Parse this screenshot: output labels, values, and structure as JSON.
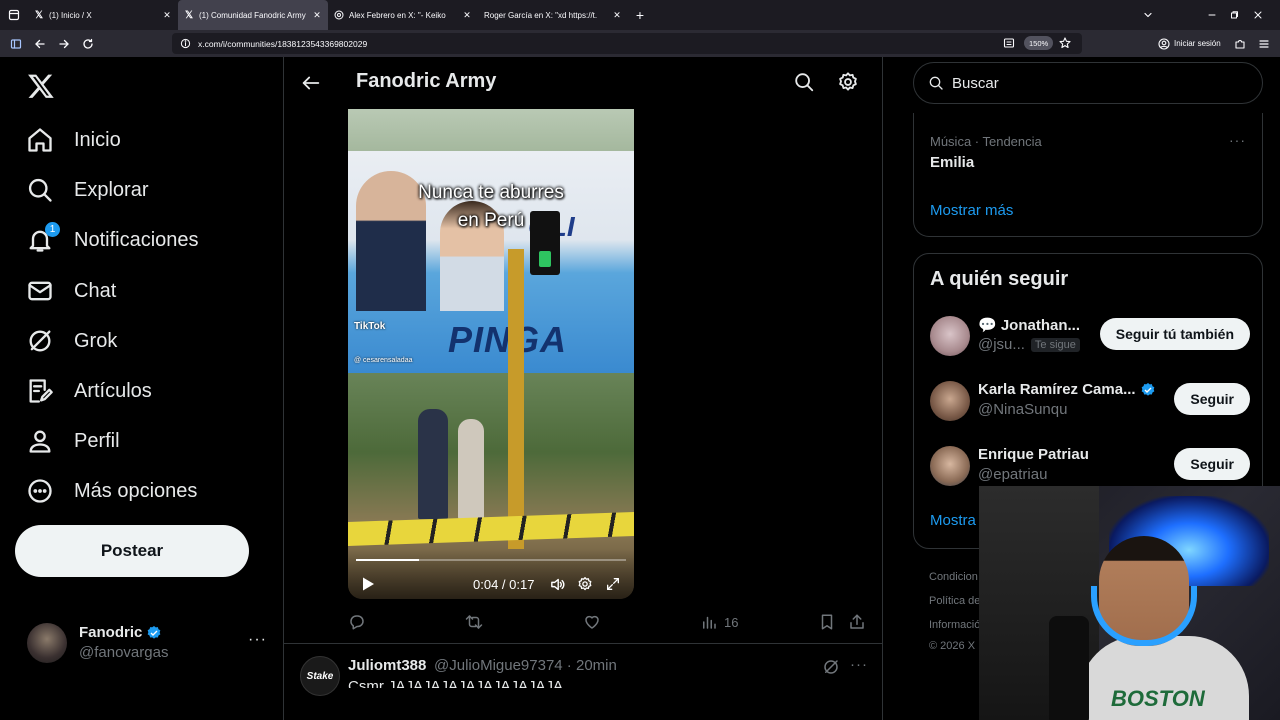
{
  "browser": {
    "tabs": [
      {
        "title": "(1) Inicio / X",
        "favicon": "X",
        "active": false
      },
      {
        "title": "(1) Comunidad Fanodric Army / X",
        "favicon": "X",
        "active": true
      },
      {
        "title": "Alex Febrero en X: \"- Keiko",
        "favicon": "globe-icon",
        "active": false
      },
      {
        "title": "Roger García en X: \"xd https://t.",
        "favicon": "",
        "active": false
      }
    ],
    "new_tab": "+",
    "url": "x.com/i/communities/1838123543369802029",
    "zoom": "150%",
    "sign_in": "Iniciar sesión"
  },
  "sidebar": {
    "items": [
      {
        "label": "Inicio",
        "icon": "home-icon"
      },
      {
        "label": "Explorar",
        "icon": "search-icon"
      },
      {
        "label": "Notificaciones",
        "icon": "bell-icon",
        "badge": "1"
      },
      {
        "label": "Chat",
        "icon": "mail-icon"
      },
      {
        "label": "Grok",
        "icon": "grok-icon"
      },
      {
        "label": "Artículos",
        "icon": "article-icon"
      },
      {
        "label": "Perfil",
        "icon": "person-icon"
      },
      {
        "label": "Más opciones",
        "icon": "more-circle-icon"
      }
    ],
    "post_button": "Postear",
    "account": {
      "name": "Fanodric",
      "handle": "@fanovargas",
      "more": "···"
    }
  },
  "main": {
    "title": "Fanodric Army",
    "video": {
      "caption_line1": "Nunca te aburres",
      "caption_line2": "en Perú",
      "watermark": "TikTok",
      "watermark_user": "@ cesarensaladaa",
      "billboard_text1": "OLI",
      "billboard_text2": "PINGA",
      "time": "0:04 / 0:17",
      "progress": 0.235
    },
    "actions": {
      "views": "16"
    },
    "reply": {
      "avatar_text": "Stake",
      "name": "Juliomt388",
      "handle": "@JulioMigue97374 · 20min",
      "text": "Csmr JAJAJAJAJAJAJAJAJAJA",
      "more": "···"
    }
  },
  "right": {
    "search_placeholder": "Buscar",
    "trend": {
      "meta": "Música · Tendencia",
      "name": "Emilia",
      "more": "···"
    },
    "show_more": "Mostrar más",
    "follow_title": "A quién seguir",
    "suggestions": [
      {
        "name": "💬 Jonathan...",
        "handle": "@jsu...",
        "tag": "Te sigue",
        "button": "Seguir tú también",
        "verified": false
      },
      {
        "name": "Karla Ramírez Cama...",
        "handle": "@NinaSunqu",
        "tag": "",
        "button": "Seguir",
        "verified": true
      },
      {
        "name": "Enrique Patriau",
        "handle": "@epatriau",
        "tag": "",
        "button": "Seguir",
        "verified": false
      }
    ],
    "show_more2": "Mostra",
    "footer": [
      "Condicion",
      "Política de",
      "Informació",
      "© 2026 X"
    ]
  },
  "webcam": {
    "shirt_text": "BOSTON"
  },
  "colors": {
    "accent": "#1d9bf0",
    "background": "#000000",
    "border": "#2f3336",
    "muted": "#71767b"
  }
}
